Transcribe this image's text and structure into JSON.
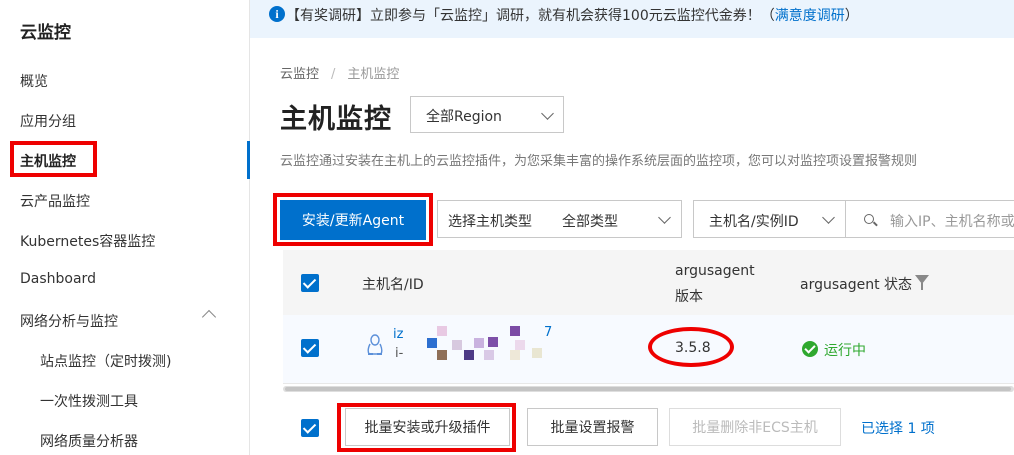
{
  "sidebar": {
    "title": "云监控",
    "items": [
      {
        "label": "概览"
      },
      {
        "label": "应用分组"
      },
      {
        "label": "主机监控"
      },
      {
        "label": "云产品监控"
      },
      {
        "label": "Kubernetes容器监控"
      },
      {
        "label": "Dashboard"
      },
      {
        "label": "网络分析与监控"
      }
    ],
    "subitems": [
      {
        "label": "站点监控（定时拨测)"
      },
      {
        "label": "一次性拨测工具"
      },
      {
        "label": "网络质量分析器"
      }
    ],
    "active": "主机监控"
  },
  "banner": {
    "icon": "i",
    "text": "【有奖调研】立即参与「云监控」调研，就有机会获得100元云监控代金券！（",
    "link": "满意度调研",
    "suffix": "）"
  },
  "breadcrumb": {
    "root": "云监控",
    "separator": "/",
    "current": "主机监控"
  },
  "page": {
    "title": "主机监控",
    "region": "全部Region",
    "description": "云监控通过安装在主机上的云监控插件，为您采集丰富的操作系统层面的监控项，您可以对监控项设置报警规则"
  },
  "toolbar": {
    "install_button": "安装/更新Agent",
    "host_type_label": "选择主机类型",
    "host_type_value": "全部类型",
    "name_select": "主机名/实例ID",
    "search_placeholder": "输入IP、主机名称或"
  },
  "table": {
    "headers": {
      "name": "主机名/ID",
      "agent_version_line1": "argusagent",
      "agent_version_line2": "版本",
      "agent_status": "argusagent 状态"
    },
    "rows": [
      {
        "name_line1": "iz",
        "name_line2": "i-",
        "suffix": "7",
        "version": "3.5.8",
        "status": "运行中"
      }
    ]
  },
  "bottom": {
    "batch_install": "批量安装或升级插件",
    "batch_alarm": "批量设置报警",
    "batch_delete": "批量删除非ECS主机",
    "selected_count": "已选择 1 项"
  },
  "colors": {
    "accent": "#0070cc",
    "highlight": "#ee0000",
    "success": "#2fa82f"
  }
}
